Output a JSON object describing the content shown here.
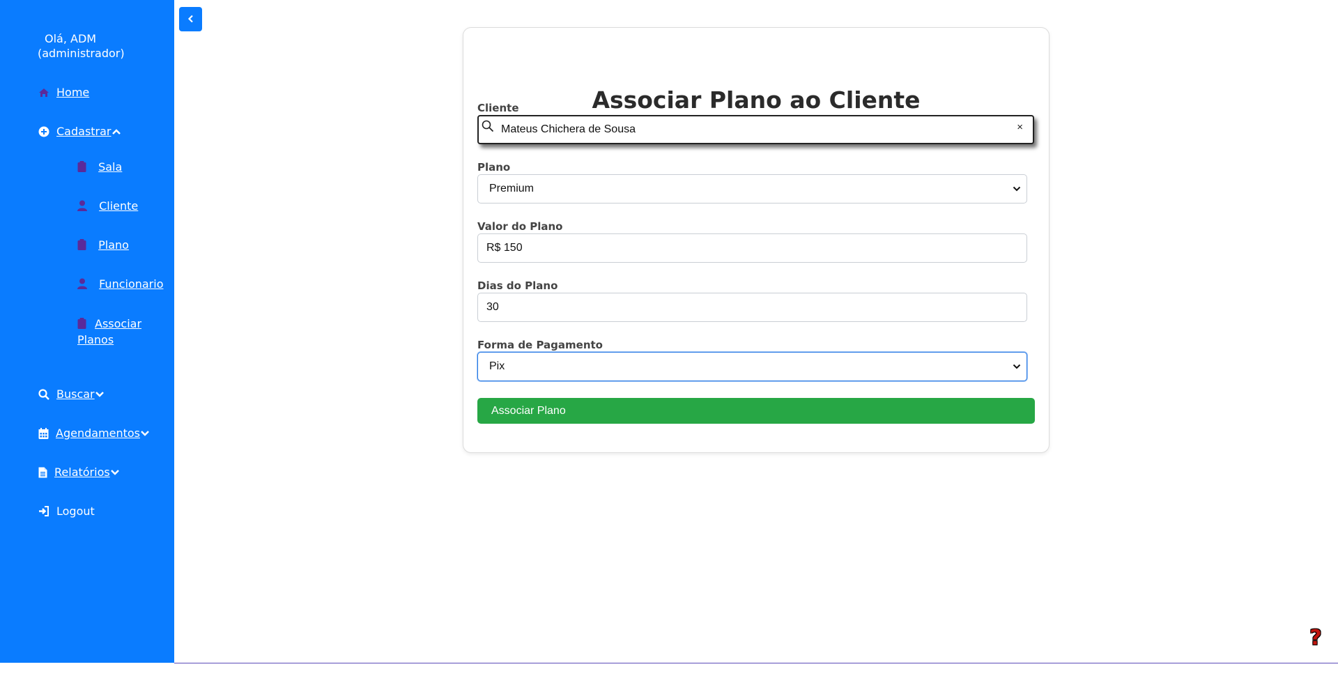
{
  "sidebar": {
    "greeting_line1": "Olá, ADM",
    "greeting_line2": "(administrador)",
    "items": {
      "home": {
        "label": "Home",
        "icon": "home-icon"
      },
      "cadastrar": {
        "label": "Cadastrar",
        "icon": "plus-circle-icon",
        "expanded": true
      },
      "buscar": {
        "label": "Buscar",
        "icon": "search-icon"
      },
      "agendamentos": {
        "label": "Agendamentos",
        "icon": "calendar-icon"
      },
      "relatorios": {
        "label": "Relatórios",
        "icon": "document-icon"
      },
      "logout": {
        "label": "Logout",
        "icon": "sign-in-icon"
      }
    },
    "subitems": {
      "sala": {
        "label": "Sala",
        "icon": "clipboard-icon"
      },
      "cliente": {
        "label": "Cliente",
        "icon": "user-icon"
      },
      "plano": {
        "label": "Plano",
        "icon": "clipboard-icon"
      },
      "funcionario": {
        "label": "Funcionario",
        "icon": "user-icon"
      },
      "associar_l1": "Associar",
      "associar_l2": "Planos"
    }
  },
  "form": {
    "title": "Associar Plano ao Cliente",
    "cliente_label": "Cliente",
    "cliente_value": "Mateus Chichera de Sousa",
    "clear_symbol": "×",
    "plano_label": "Plano",
    "plano_value": "Premium",
    "valor_label": "Valor do Plano",
    "valor_value": "R$ 150",
    "dias_label": "Dias do Plano",
    "dias_value": "30",
    "pagamento_label": "Forma de Pagamento",
    "pagamento_value": "Pix",
    "submit_label": "Associar Plano"
  },
  "help": {
    "symbol": "?"
  },
  "colors": {
    "sidebar": "#0a7cff",
    "submenu_icon": "#5a2a9a",
    "submit": "#27a745",
    "help": "#c0160f"
  }
}
